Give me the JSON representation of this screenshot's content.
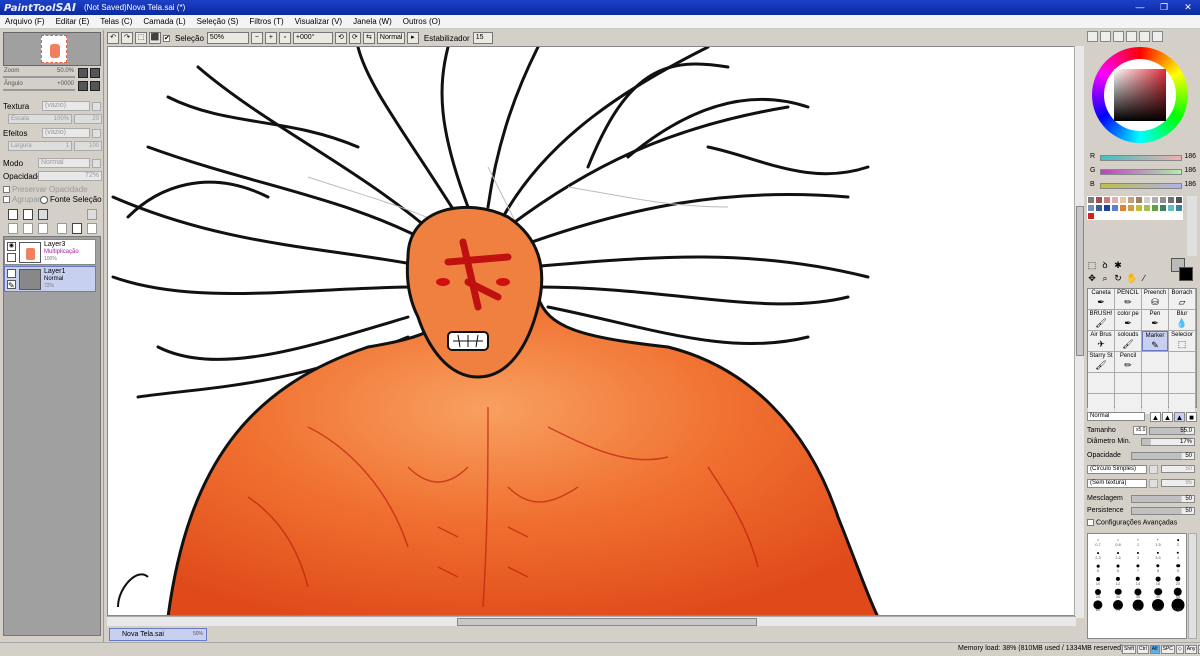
{
  "title_bar": {
    "logo_prefix": "PaintTool",
    "logo_name": "SAI",
    "title": "(Not Saved)Nova Tela.sai (*)",
    "minimize": "—",
    "restore": "❐",
    "close": "✕"
  },
  "menu": [
    "Arquivo (F)",
    "Editar (E)",
    "Telas (C)",
    "Camada (L)",
    "Seleção (S)",
    "Filtros (T)",
    "Visualizar (V)",
    "Janela (W)",
    "Outros (O)"
  ],
  "toolbar": {
    "selection_label": "Seleção",
    "selection_checked": true,
    "zoom": "50%",
    "angle": "+000°",
    "mode": "Normal",
    "stabilizer_label": "Estabilizador",
    "stabilizer_value": "15"
  },
  "navigator": {
    "zoom_label": "Zoom",
    "zoom_value": "50.0%",
    "angle_label": "Ângulo",
    "angle_value": "+0000"
  },
  "layer_props": {
    "texture_label": "Textura",
    "texture_value": "(vazio)",
    "scale_label": "Escala",
    "scale_value": "100%",
    "scale_num": "20",
    "effects_label": "Efeitos",
    "effects_value": "(vazio)",
    "width_label": "Largura",
    "width_num": "1",
    "width_val": "100",
    "mode_label": "Modo",
    "mode_value": "Normal",
    "opacity_label": "Opacidade",
    "opacity_value": "72%",
    "preserve_opacity": "Preservar Opacidade",
    "group": "Agrupar",
    "selection_source": "Fonte Seleção"
  },
  "layers": [
    {
      "name": "Layer3",
      "mode": "Multiplicação",
      "opacity": "100%",
      "selected": false
    },
    {
      "name": "Layer1",
      "mode": "Normal",
      "opacity": "72%",
      "selected": true
    }
  ],
  "document_tab": {
    "name": "Nova Tela.sai",
    "zoom": "50%"
  },
  "color": {
    "r_label": "R",
    "r_value": "186",
    "g_label": "G",
    "g_value": "186",
    "b_label": "B",
    "b_value": "186",
    "foreground": "#bababa",
    "background": "#000000"
  },
  "palette": [
    "#7a7a7a",
    "#a05050",
    "#c08080",
    "#e0b0b0",
    "#e8c8a0",
    "#c0a080",
    "#a08060",
    "#d0d0d0",
    "#b0b0b0",
    "#909090",
    "#707070",
    "#505050",
    "#7090c0",
    "#3060a0",
    "#2040a0",
    "#5a80d0",
    "#e08030",
    "#d0a040",
    "#c0c030",
    "#a0c050",
    "#60a040",
    "#408060",
    "#60c0c0",
    "#4080a0",
    "#d02020",
    "#ffffff",
    "#ffffff",
    "#ffffff",
    "#ffffff",
    "#ffffff",
    "#ffffff",
    "#ffffff",
    "#ffffff",
    "#ffffff",
    "#ffffff",
    "#ffffff"
  ],
  "brushes": [
    {
      "name": "Caneta",
      "icon": "pen-icon"
    },
    {
      "name": "PENCIL",
      "icon": "pencil-icon"
    },
    {
      "name": "Preench",
      "icon": "bucket-icon"
    },
    {
      "name": "Borrach",
      "icon": "eraser-icon"
    },
    {
      "name": "BRUSH!",
      "icon": "brush-icon"
    },
    {
      "name": "color pe",
      "icon": "pen-icon"
    },
    {
      "name": "Pen",
      "icon": "pen-icon"
    },
    {
      "name": "Blur",
      "icon": "blur-icon"
    },
    {
      "name": "Air Brus",
      "icon": "airbrush-icon"
    },
    {
      "name": "solouds",
      "icon": "brush-icon"
    },
    {
      "name": "Marker",
      "icon": "marker-icon",
      "selected": true
    },
    {
      "name": "Selecior",
      "icon": "selection-icon"
    },
    {
      "name": "Starry St",
      "icon": "brush-icon"
    },
    {
      "name": "Pencil",
      "icon": "pencil-icon"
    },
    {
      "name": "",
      "icon": ""
    },
    {
      "name": "",
      "icon": ""
    },
    {
      "name": "",
      "icon": ""
    },
    {
      "name": "",
      "icon": ""
    },
    {
      "name": "",
      "icon": ""
    },
    {
      "name": "",
      "icon": ""
    },
    {
      "name": "",
      "icon": ""
    },
    {
      "name": "",
      "icon": ""
    },
    {
      "name": "",
      "icon": ""
    },
    {
      "name": "",
      "icon": ""
    }
  ],
  "brush_props": {
    "mode": "Normal",
    "size_label": "Tamanho",
    "size_mult": "x5.0",
    "size_value": "55.0",
    "min_diameter_label": "Diâmetro Min.",
    "min_diameter_value": "17%",
    "opacity_label": "Opacidade",
    "opacity_value": "50",
    "shape": "(Círculo Simples)",
    "shape_value": "50",
    "texture": "(Sem textura)",
    "texture_value": "95",
    "blending_label": "Mesclagem",
    "blending_value": "50",
    "persistence_label": "Persistence",
    "persistence_value": "50",
    "advanced": "Configurações Avançadas"
  },
  "sizes": [
    "0.7",
    "0.8",
    "1",
    "1.5",
    "2",
    "2.3",
    "2.6",
    "3",
    "3.5",
    "4",
    "5",
    "6",
    "7",
    "8",
    "9",
    "10",
    "12",
    "14",
    "16",
    "20",
    "25",
    "30",
    "35",
    "40",
    "50",
    "60",
    "70",
    "80",
    "100",
    "120"
  ],
  "status": {
    "memory": "Memory load: 38% (810MB used / 1334MB reserved)",
    "keys": [
      "Shift",
      "Ctrl",
      "Alt",
      "SPC",
      "◇",
      "Any",
      "∕"
    ]
  }
}
